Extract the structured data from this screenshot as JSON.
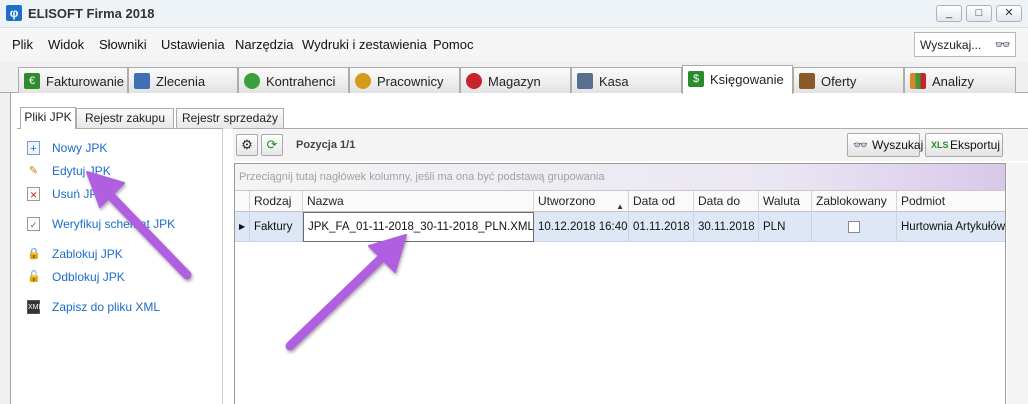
{
  "window": {
    "title": "ELISOFT Firma 2018",
    "controls": [
      "_",
      "□",
      "✕"
    ]
  },
  "menu": [
    "Plik",
    "Widok",
    "Słowniki",
    "Ustawienia",
    "Narzędzia",
    "Wydruki i zestawienia",
    "Pomoc"
  ],
  "search": {
    "placeholder": "Wyszukaj..."
  },
  "module_tabs": [
    {
      "label": "Fakturowanie",
      "icon": "euro-icon",
      "color": "#2e8b2e"
    },
    {
      "label": "Zlecenia",
      "icon": "documents-icon",
      "color": "#3f6fb5"
    },
    {
      "label": "Kontrahenci",
      "icon": "people-icon",
      "color": "#3ba03b"
    },
    {
      "label": "Pracownicy",
      "icon": "workers-icon",
      "color": "#d59a1a"
    },
    {
      "label": "Magazyn",
      "icon": "bags-icon",
      "color": "#c9232c"
    },
    {
      "label": "Kasa",
      "icon": "cashbox-icon",
      "color": "#5a6f8f"
    },
    {
      "label": "Księgowanie",
      "icon": "ledger-icon",
      "color": "#2b8a2b",
      "active": true
    },
    {
      "label": "Oferty",
      "icon": "briefcase-icon",
      "color": "#8a5a2b"
    },
    {
      "label": "Analizy",
      "icon": "bar-chart-icon",
      "color": "#d9862a"
    }
  ],
  "sub_tabs": [
    "Pliki JPK",
    "Rejestr zakupu",
    "Rejestr sprzedaży"
  ],
  "actions": {
    "new": "Nowy JPK",
    "edit": "Edytuj JPK",
    "delete": "Usuń JPK",
    "verify": "Weryfikuj schemat JPK",
    "lock": "Zablokuj JPK",
    "unlock": "Odblokuj JPK",
    "save_xml": "Zapisz do pliku XML"
  },
  "toolbar": {
    "position": "Pozycja 1/1",
    "search_button": "Wyszukaj",
    "export_button": "Eksportuj"
  },
  "grid": {
    "group_hint": "Przeciągnij tutaj nagłówek kolumny, jeśli ma ona być podstawą grupowania",
    "columns": [
      "Rodzaj",
      "Nazwa",
      "Utworzono",
      "Data od",
      "Data do",
      "Waluta",
      "Zablokowany",
      "Podmiot"
    ],
    "rows": [
      {
        "rodzaj": "Faktury",
        "nazwa": "JPK_FA_01-11-2018_30-11-2018_PLN.XML",
        "utworzono": "10.12.2018 16:40",
        "data_od": "01.11.2018",
        "data_do": "30.11.2018",
        "waluta": "PLN",
        "zablokowany": false,
        "podmiot": "Hurtownia Artykułów"
      }
    ]
  },
  "annotation_color": "#b05ee0"
}
